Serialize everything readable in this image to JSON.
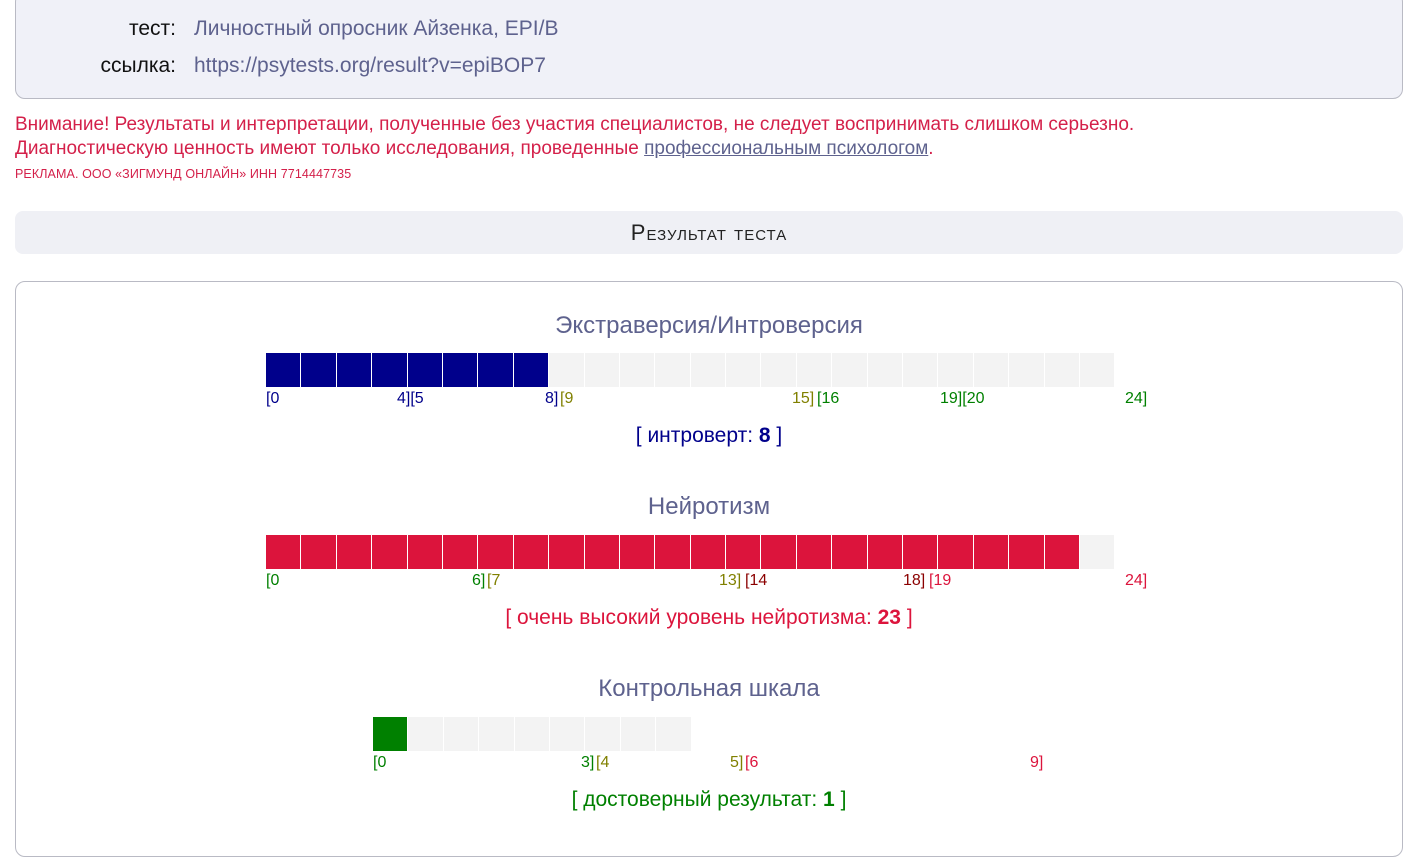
{
  "info": {
    "test_label": "тест:",
    "test_value": "Личностный опросник Айзенка, EPI/B",
    "link_label": "ссылка:",
    "link_value": "https://psytests.org/result?v=epiBOP7"
  },
  "warning": {
    "line1": "Внимание! Результаты и интерпретации, полученные без участия специалистов, не следует воспринимать слишком серьезно.",
    "line2_prefix": "Диагностическую ценность имеют только исследования, проведенные ",
    "line2_link": "профессиональным психологом",
    "line2_suffix": ".",
    "ad": "РЕКЛАМА. ООО «ЗИГМУНД ОНЛАЙН» ИНН 7714447735"
  },
  "result_header": "Результат теста",
  "colors": {
    "blue": "#00008b",
    "olive": "#808000",
    "green": "#008000",
    "red": "#dc143c",
    "dark_red": "#8b0000",
    "empty": "#f3f3f3"
  },
  "scales": [
    {
      "title": "Экстраверсия/Интроверсия",
      "max": 24,
      "value": 8,
      "fill_color": "blue",
      "ticks": [
        {
          "text": "[0",
          "color": "blue"
        },
        {
          "text": "4][5",
          "color": "blue"
        },
        {
          "text": "8]",
          "color": "blue"
        },
        {
          "text": "[9",
          "color": "olive"
        },
        {
          "text": "15]",
          "color": "olive"
        },
        {
          "text": "[16",
          "color": "green"
        },
        {
          "text": "19][20",
          "color": "green"
        },
        {
          "text": "24]",
          "color": "green"
        }
      ],
      "verdict_text": "[ интроверт: ",
      "verdict_value": "8",
      "verdict_close": " ]",
      "verdict_color": "blue"
    },
    {
      "title": "Нейротизм",
      "max": 24,
      "value": 23,
      "fill_color": "red",
      "ticks": [
        {
          "text": "[0",
          "color": "green"
        },
        {
          "text": "6]",
          "color": "green"
        },
        {
          "text": "[7",
          "color": "olive"
        },
        {
          "text": "13]",
          "color": "olive"
        },
        {
          "text": "[14",
          "color": "dark_red"
        },
        {
          "text": "18]",
          "color": "dark_red"
        },
        {
          "text": "[19",
          "color": "red"
        },
        {
          "text": "24]",
          "color": "red"
        }
      ],
      "verdict_text": "[ очень высокий уровень нейротизма: ",
      "verdict_value": "23",
      "verdict_close": " ]",
      "verdict_color": "red"
    },
    {
      "title": "Контрольная шкала",
      "max": 9,
      "value": 1,
      "fill_color": "green",
      "ticks": [
        {
          "text": "[0",
          "color": "green"
        },
        {
          "text": "3]",
          "color": "green"
        },
        {
          "text": "[4",
          "color": "olive"
        },
        {
          "text": "5]",
          "color": "olive"
        },
        {
          "text": "[6",
          "color": "red"
        },
        {
          "text": "9]",
          "color": "red"
        }
      ],
      "verdict_text": "[ достоверный результат: ",
      "verdict_value": "1",
      "verdict_close": " ]",
      "verdict_color": "green"
    }
  ]
}
